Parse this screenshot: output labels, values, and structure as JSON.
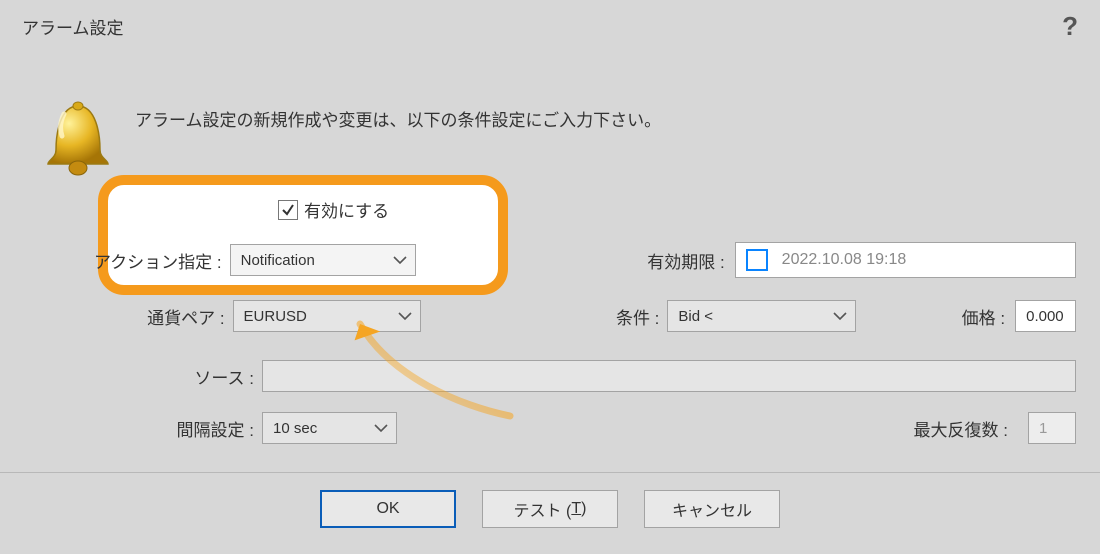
{
  "title": "アラーム設定",
  "help_symbol": "?",
  "intro": "アラーム設定の新規作成や変更は、以下の条件設定にご入力下さい。",
  "enable": {
    "label": "有効にする",
    "checked": true
  },
  "action": {
    "label": "アクション指定 :",
    "value": "Notification"
  },
  "expiration": {
    "label": "有効期限 :",
    "value": "2022.10.08 19:18",
    "checked": false
  },
  "pair": {
    "label": "通貨ペア :",
    "value": "EURUSD"
  },
  "condition": {
    "label": "条件 :",
    "value": "Bid <"
  },
  "price": {
    "label": "価格 :",
    "value": "0.000"
  },
  "source": {
    "label": "ソース :",
    "value": ""
  },
  "timeout": {
    "label": "間隔設定 :",
    "value": "10 sec"
  },
  "max_iter": {
    "label": "最大反復数 :",
    "value": "1"
  },
  "buttons": {
    "ok": "OK",
    "test_pre": "テスト (",
    "test_key": "T",
    "test_post": ")",
    "cancel": "キャンセル"
  }
}
